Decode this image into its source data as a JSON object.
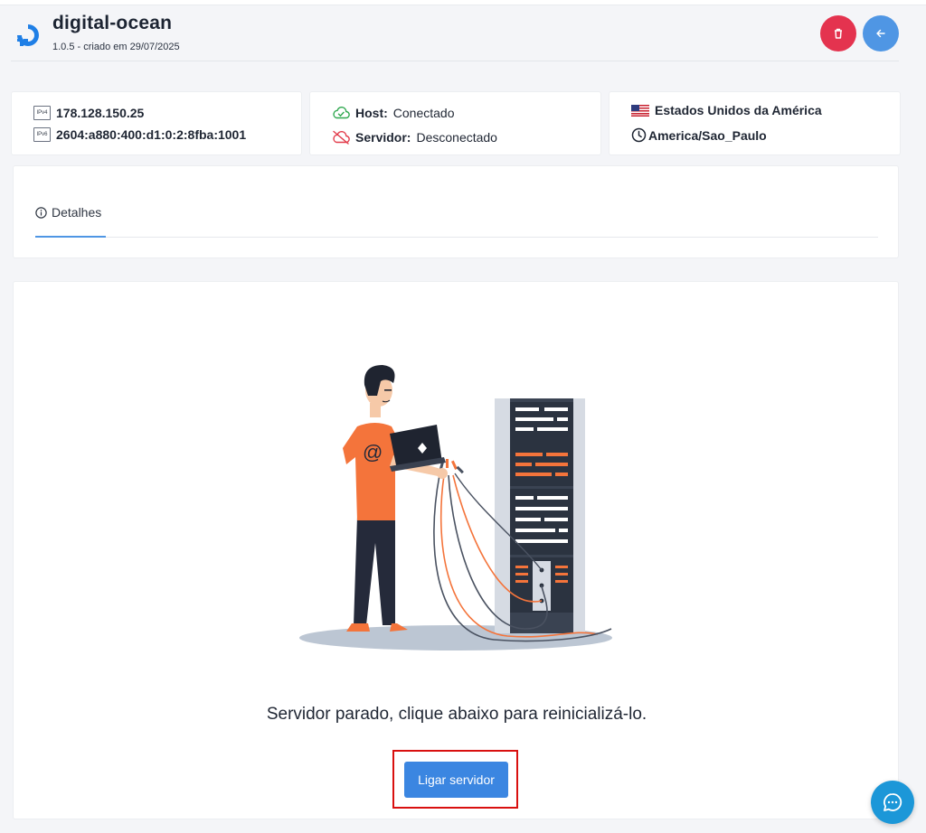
{
  "header": {
    "app_name": "digital-ocean",
    "subtitle": "1.0.5 - criado em 29/07/2025",
    "delete_button_color": "#e4334f",
    "back_button_color": "#4f96e4"
  },
  "ip_card": {
    "ipv4_tag": "IPv4",
    "ipv4": "178.128.150.25",
    "ipv6_tag": "IPv6",
    "ipv6": "2604:a880:400:d1:0:2:8fba:1001"
  },
  "status_card": {
    "host_label": "Host:",
    "host_value": "Conectado",
    "server_label": "Servidor:",
    "server_value": "Desconectado",
    "connected_color": "#2fa84f",
    "disconnected_color": "#e23c4b"
  },
  "location_card": {
    "country": "Estados Unidos da América",
    "timezone": "America/Sao_Paulo",
    "flag_icon": "us-flag-icon",
    "clock_icon": "clock-icon"
  },
  "tabs": [
    {
      "label": "Detalhes",
      "icon": "info-icon",
      "active": true
    }
  ],
  "main": {
    "message": "Servidor parado, clique abaixo para reinicializá-lo.",
    "start_button_label": "Ligar servidor",
    "accent": "#3b86e1"
  },
  "chat": {
    "icon": "chat-icon"
  }
}
